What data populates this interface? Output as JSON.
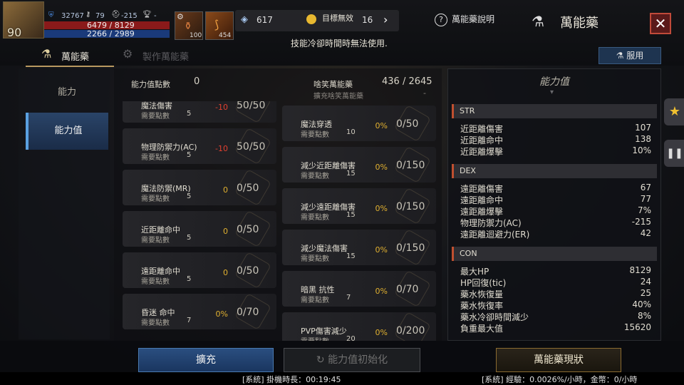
{
  "player": {
    "level": "90",
    "combat_power": "32767",
    "key_count": "79",
    "helmet_count": "-215",
    "trophy": "-",
    "hp": "6479 / 8129",
    "mp": "2266 / 2989"
  },
  "quick_slots": [
    {
      "icon": "potion-icon",
      "count": "100"
    },
    {
      "icon": "horn-icon",
      "count": "454"
    }
  ],
  "resources": {
    "crystal": "617",
    "gold": "16",
    "overlay_text": "目標無效"
  },
  "header": {
    "help_label": "萬能藥說明",
    "title": "萬能藥",
    "notice": "技能冷卻時間時無法使用."
  },
  "tabs": [
    {
      "label": "萬能藥",
      "active": true
    },
    {
      "label": "製作萬能藥",
      "active": false
    }
  ],
  "use_button": "服用",
  "nav": [
    {
      "label": "能力",
      "active": false
    },
    {
      "label": "能力值",
      "active": true
    }
  ],
  "points": {
    "label": "能力值點數",
    "value": "0"
  },
  "absorb": {
    "label": "啥笑萬能藥",
    "sub": "擴充啥笑萬能藥",
    "value": "436 / 2645",
    "sub_value": "-"
  },
  "left_cards": [
    {
      "name": "魔法傷害",
      "pts_label": "需要點數",
      "pts": "5",
      "pct": "-10",
      "progress": "50/50",
      "neg": true
    },
    {
      "name": "物理防禦力(AC)",
      "pts_label": "需要點數",
      "pts": "5",
      "pct": "-10",
      "progress": "50/50",
      "neg": true
    },
    {
      "name": "魔法防禦(MR)",
      "pts_label": "需要點數",
      "pts": "5",
      "pct": "0",
      "progress": "0/50",
      "neg": false
    },
    {
      "name": "近距離命中",
      "pts_label": "需要點數",
      "pts": "5",
      "pct": "0",
      "progress": "0/50",
      "neg": false
    },
    {
      "name": "遠距離命中",
      "pts_label": "需要點數",
      "pts": "5",
      "pct": "0",
      "progress": "0/50",
      "neg": false
    },
    {
      "name": "昏迷 命中",
      "pts_label": "需要點數",
      "pts": "7",
      "pct": "0%",
      "progress": "0/70",
      "neg": false
    }
  ],
  "right_cards": [
    {
      "name": "魔法穿透",
      "pts_label": "需要點數",
      "pts": "10",
      "pct": "0%",
      "progress": "0/50"
    },
    {
      "name": "減少近距離傷害",
      "pts_label": "需要點數",
      "pts": "15",
      "pct": "0%",
      "progress": "0/150"
    },
    {
      "name": "減少遠距離傷害",
      "pts_label": "需要點數",
      "pts": "15",
      "pct": "0%",
      "progress": "0/150"
    },
    {
      "name": "減少魔法傷害",
      "pts_label": "需要點數",
      "pts": "15",
      "pct": "0%",
      "progress": "0/150"
    },
    {
      "name": "暗黑 抗性",
      "pts_label": "需要點數",
      "pts": "7",
      "pct": "0%",
      "progress": "0/70"
    },
    {
      "name": "PVP傷害減少",
      "pts_label": "需要點數",
      "pts": "20",
      "pct": "0%",
      "progress": "0/200"
    }
  ],
  "stats_panel": {
    "title": "能力值",
    "sections": [
      {
        "name": "STR",
        "rows": [
          {
            "label": "近距離傷害",
            "value": "107"
          },
          {
            "label": "近距離命中",
            "value": "138"
          },
          {
            "label": "近距離爆擊",
            "value": "10%"
          }
        ]
      },
      {
        "name": "DEX",
        "rows": [
          {
            "label": "遠距離傷害",
            "value": "67"
          },
          {
            "label": "遠距離命中",
            "value": "77"
          },
          {
            "label": "遠距離爆擊",
            "value": "7%"
          },
          {
            "label": "物理防禦力(AC)",
            "value": "-215"
          },
          {
            "label": "遠距離迴避力(ER)",
            "value": "42"
          }
        ]
      },
      {
        "name": "CON",
        "rows": [
          {
            "label": "最大HP",
            "value": "8129"
          },
          {
            "label": "HP回復(tic)",
            "value": "24"
          },
          {
            "label": "藥水恢復量",
            "value": "25"
          },
          {
            "label": "藥水恢復率",
            "value": "40%"
          },
          {
            "label": "藥水冷卻時間減少",
            "value": "8%"
          },
          {
            "label": "負重最大值",
            "value": "15620"
          }
        ]
      }
    ]
  },
  "bottom": {
    "expand": "擴充",
    "reset": "能力值初始化",
    "status": "萬能藥現狀"
  },
  "syslog": {
    "left": "[系統] 掛機時長：00:19:45",
    "right": "[系統] 經驗：0.0026%/小時，金幣：0/小時"
  },
  "colors": {
    "accent_blue": "#2a4e80",
    "negative": "#e04030",
    "positive": "#e0b030"
  }
}
